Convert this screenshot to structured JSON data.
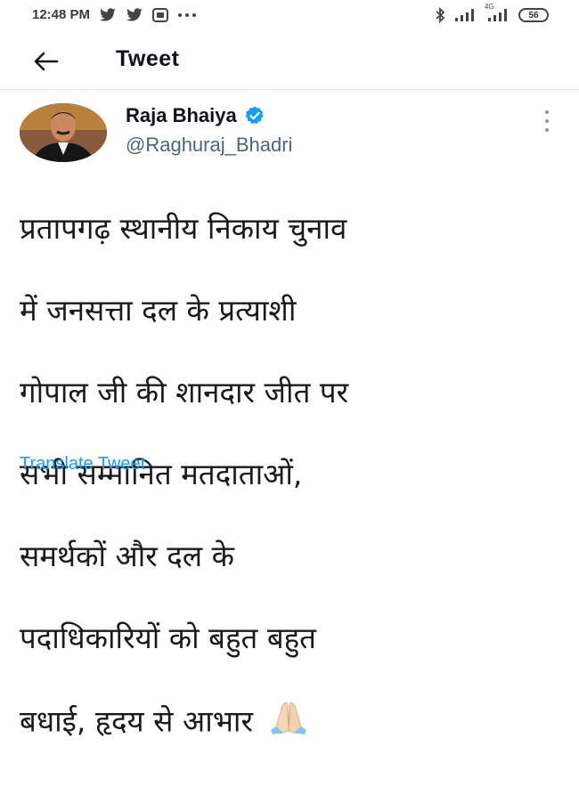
{
  "status_bar": {
    "time": "12:48 PM",
    "left_icons": [
      "twitter-bird-icon",
      "twitter-bird-icon",
      "app-notification-icon",
      "more-dots-icon"
    ],
    "right_icons": [
      "bluetooth-icon",
      "signal-icon",
      "4g-signal-icon"
    ],
    "network_label": "4G",
    "battery": "56"
  },
  "header": {
    "back_icon": "arrow-left-icon",
    "title": "Tweet"
  },
  "tweet": {
    "author_name": "Raja Bhaiya",
    "verified_icon": "verified-badge-icon",
    "handle": "@Raghuraj_Bhadri",
    "more_icon": "vertical-dots-icon",
    "lines": [
      "प्रतापगढ़ स्थानीय निकाय चुनाव",
      "में जनसत्ता दल के प्रत्याशी",
      "गोपाल जी की शानदार जीत पर",
      "सभी सम्मानित मतदाताओं,",
      "समर्थकों और दल के",
      "पदाधिकारियों को बहुत बहुत",
      "बधाई, हृदय से आभार"
    ],
    "emoji": "folded-hands-emoji",
    "translate_label": "Translate Tweet"
  },
  "colors": {
    "link": "#1d9bf0",
    "verified": "#1d9bf0",
    "handle": "#536471"
  }
}
